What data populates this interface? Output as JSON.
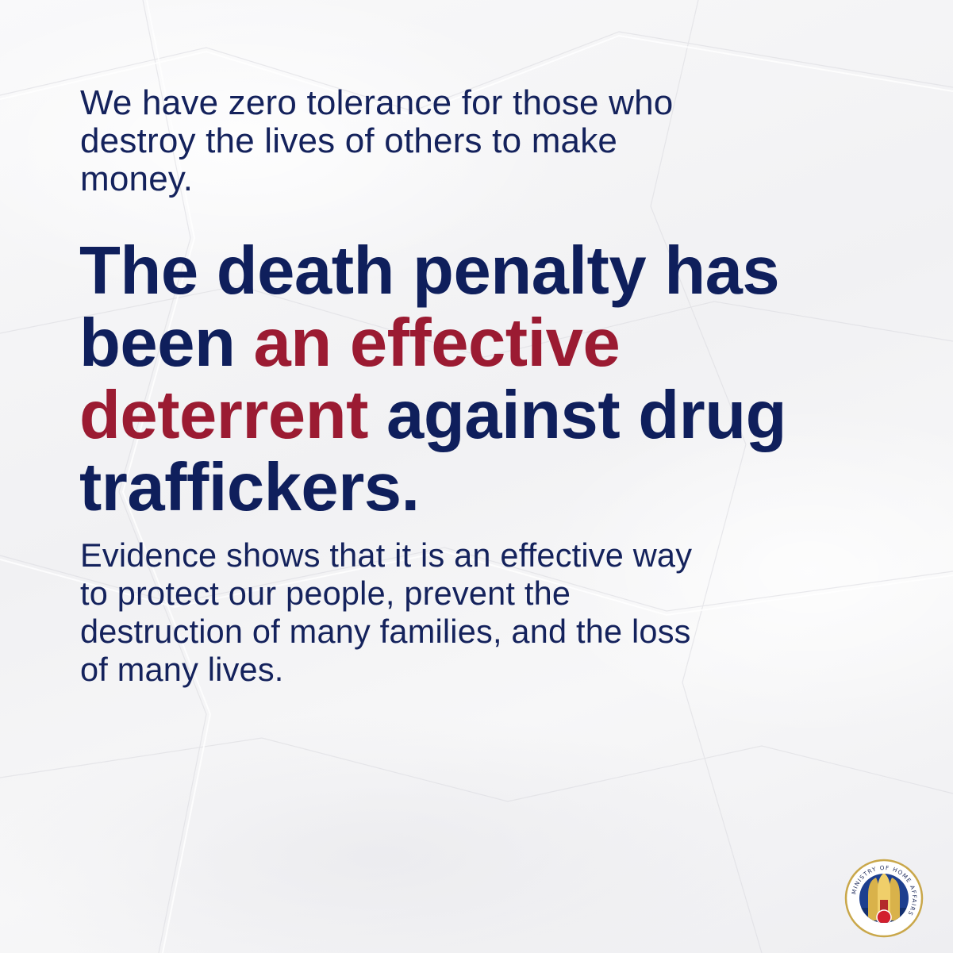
{
  "intro": {
    "line1": "We have zero tolerance for those who",
    "line2": "destroy the lives of others to make",
    "line3": "money."
  },
  "headline": {
    "line1": "The death penalty has",
    "line2_plain": "been ",
    "line2_accent": "an effective",
    "line3_accent": "deterrent",
    "line3_plain": " against drug",
    "line4": "traffickers."
  },
  "evidence": {
    "line1": "Evidence shows that it is an effective way",
    "line2": "to protect our people, prevent the",
    "line3": "destruction of many families, and the loss",
    "line4": "of many lives."
  },
  "logo": {
    "ring_text": "MINISTRY OF HOME AFFAIRS",
    "icon": "mha-crest-icon"
  },
  "colors": {
    "navy": "#0f1f5c",
    "crimson": "#9b1b32",
    "paper": "#f6f6f7"
  }
}
